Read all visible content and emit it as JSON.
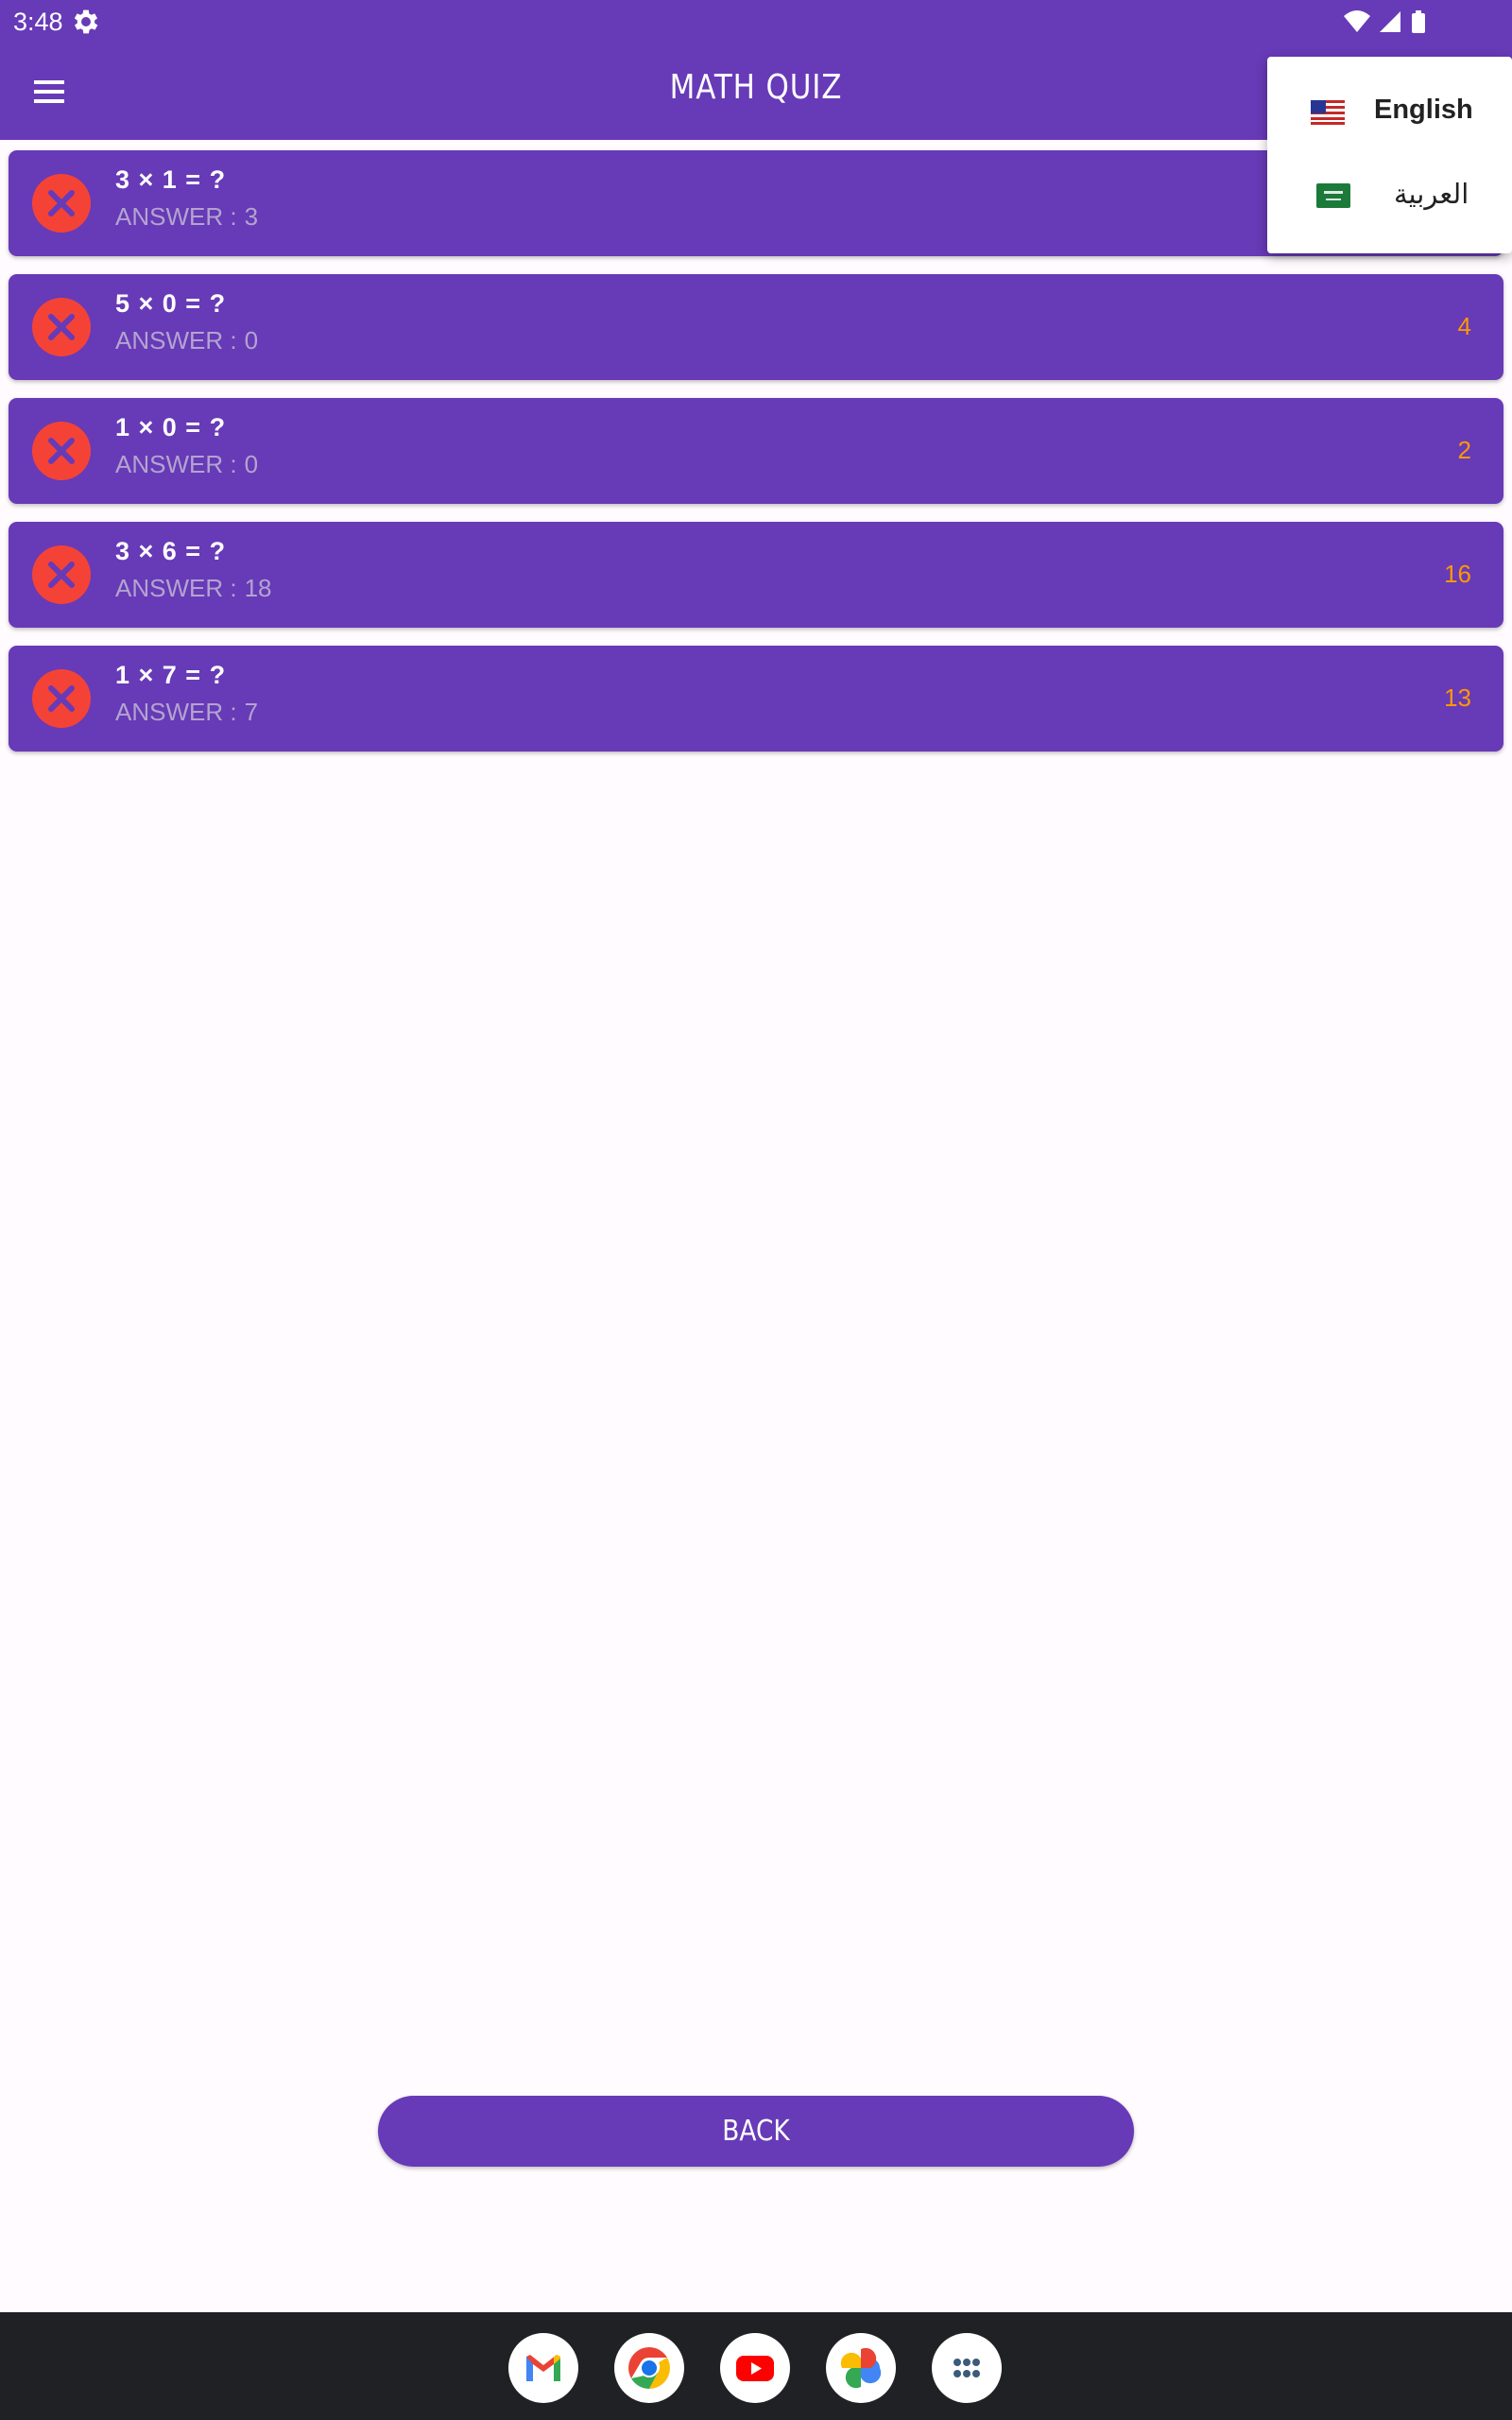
{
  "status_bar": {
    "time": "3:48"
  },
  "app_bar": {
    "title": "MATH QUIZ"
  },
  "colors": {
    "primary": "#673ab7",
    "wrong_badge": "#f44336",
    "user_answer": "#ff9800",
    "answer_label": "#b3a4cf"
  },
  "results": [
    {
      "question": "3 × 1 = ?",
      "answer_label": "ANSWER :",
      "answer": "3",
      "user_answer": "",
      "status": "wrong"
    },
    {
      "question": "5 × 0 = ?",
      "answer_label": "ANSWER :",
      "answer": "0",
      "user_answer": "4",
      "status": "wrong"
    },
    {
      "question": "1 × 0 = ?",
      "answer_label": "ANSWER :",
      "answer": "0",
      "user_answer": "2",
      "status": "wrong"
    },
    {
      "question": "3 × 6 = ?",
      "answer_label": "ANSWER :",
      "answer": "18",
      "user_answer": "16",
      "status": "wrong"
    },
    {
      "question": "1 × 7 = ?",
      "answer_label": "ANSWER :",
      "answer": "7",
      "user_answer": "13",
      "status": "wrong"
    }
  ],
  "language_menu": {
    "items": [
      {
        "label": "English",
        "flag": "us-flag-icon",
        "selected": true
      },
      {
        "label": "العربية",
        "flag": "saudi-flag-icon",
        "selected": false
      }
    ]
  },
  "back_button": {
    "label": "BACK"
  },
  "dock": {
    "apps": [
      "gmail-icon",
      "chrome-icon",
      "youtube-icon",
      "photos-icon",
      "app-drawer-icon"
    ]
  }
}
